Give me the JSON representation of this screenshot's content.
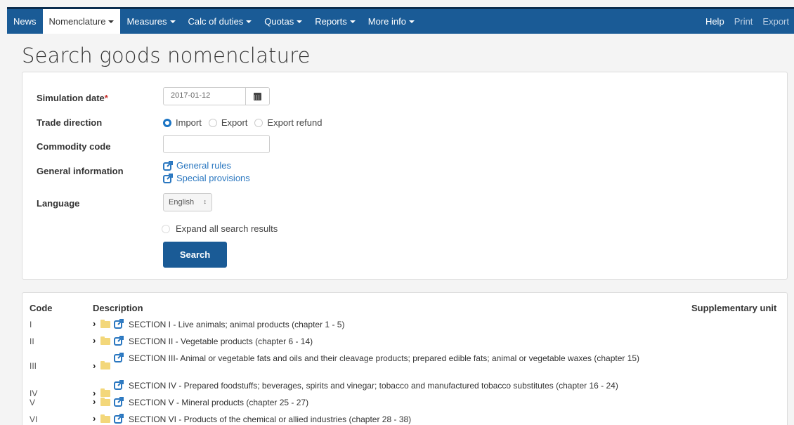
{
  "nav": {
    "items": [
      {
        "label": "News",
        "active": false
      },
      {
        "label": "Nomenclature",
        "active": true,
        "caret": true
      },
      {
        "label": "Measures",
        "caret": true
      },
      {
        "label": "Calc of duties",
        "caret": true
      },
      {
        "label": "Quotas",
        "caret": true
      },
      {
        "label": "Reports",
        "caret": true
      },
      {
        "label": "More info",
        "caret": true
      }
    ],
    "right": [
      "Help",
      "Print",
      "Export"
    ]
  },
  "page_title": "Search goods nomenclature",
  "form": {
    "simulation_date_label": "Simulation date",
    "required_mark": "*",
    "simulation_date_value": "2017-01-12",
    "trade_direction_label": "Trade direction",
    "trade_options": [
      "Import",
      "Export",
      "Export refund"
    ],
    "trade_selected": "Import",
    "commodity_code_label": "Commodity code",
    "commodity_code_value": "",
    "general_info_label": "General information",
    "general_rules_link": "General rules",
    "special_provisions_link": "Special provisions",
    "language_label": "Language",
    "language_value": "English",
    "expand_label": "Expand all search results",
    "search_button": "Search"
  },
  "results": {
    "headers": {
      "code": "Code",
      "description": "Description",
      "supplementary": "Supplementary unit"
    },
    "rows": [
      {
        "code": "I",
        "description": "SECTION I - Live animals; animal products (chapter 1 - 5)"
      },
      {
        "code": "II",
        "description": "SECTION II - Vegetable products (chapter 6 - 14)"
      },
      {
        "code": "III",
        "description": "SECTION III- Animal or vegetable fats and oils and their cleavage products; prepared edible fats; animal or vegetable waxes (chapter 15)"
      },
      {
        "code": "IV",
        "description": "SECTION IV - Prepared foodstuffs; beverages, spirits and vinegar; tobacco and manufactured tobacco substitutes (chapter 16 - 24)"
      },
      {
        "code": "V",
        "description": "SECTION V - Mineral products (chapter 25 - 27)"
      },
      {
        "code": "VI",
        "description": "SECTION VI - Products of the chemical or allied industries (chapter 28 - 38)"
      }
    ]
  },
  "colors": {
    "nav_bg": "#1a5b96",
    "link": "#2a77c0",
    "required": "#c9302c",
    "folder": "#f3d77a"
  }
}
